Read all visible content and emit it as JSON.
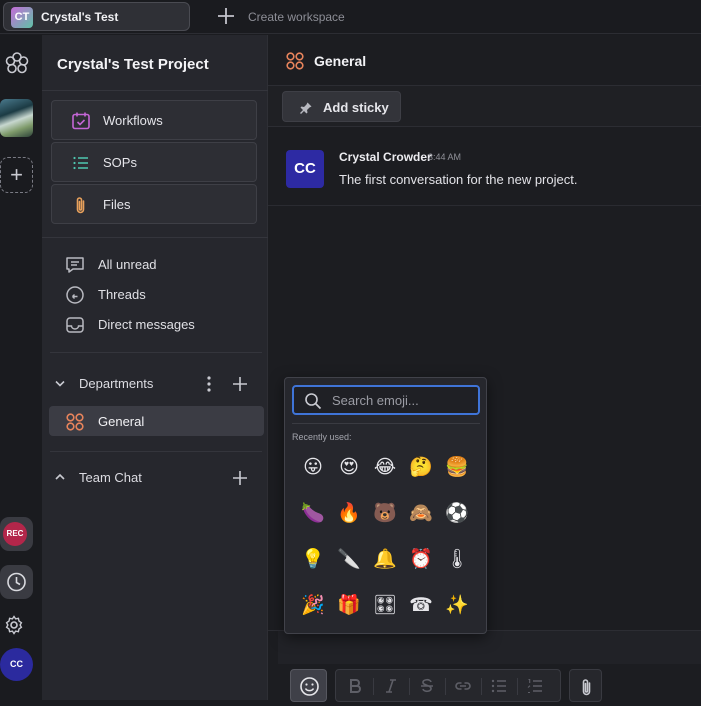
{
  "workspace": {
    "tab_initials": "CT",
    "tab_name": "Crystal's Test",
    "create_label": "Create workspace"
  },
  "rail": {
    "rec_label": "REC",
    "user_initials": "CC"
  },
  "sidebar": {
    "project_title": "Crystal's Test Project",
    "tools": [
      {
        "label": "Workflows",
        "icon": "calendar-check-icon"
      },
      {
        "label": "SOPs",
        "icon": "list-icon"
      },
      {
        "label": "Files",
        "icon": "paperclip-icon"
      }
    ],
    "nav": [
      {
        "label": "All unread",
        "icon": "message-icon"
      },
      {
        "label": "Threads",
        "icon": "threads-icon"
      },
      {
        "label": "Direct messages",
        "icon": "inbox-icon"
      }
    ],
    "departments_label": "Departments",
    "channel_general": "General",
    "team_chat_label": "Team Chat"
  },
  "main": {
    "channel_title": "General",
    "add_sticky_label": "Add sticky",
    "message": {
      "avatar_initials": "CC",
      "author": "Crystal Crowder",
      "time": "3:44 AM",
      "text": "The first conversation for the new project."
    }
  },
  "emoji_picker": {
    "search_placeholder": "Search emoji...",
    "recent_label": "Recently used:",
    "emojis": [
      "😛",
      "😍",
      "😂",
      "🤔",
      "🍔",
      "🍆",
      "🔥",
      "🐻",
      "🙈",
      "⚽",
      "💡",
      "🔪",
      "🔔",
      "⏰",
      "🌡",
      "🎉",
      "🎁",
      "🎛",
      "☎",
      "✨"
    ]
  },
  "colors": {
    "accent_orange": "#e8845c",
    "avatar_blue": "#2d2aa3",
    "search_focus": "#3f74d8",
    "rec_red": "#b3264a"
  }
}
